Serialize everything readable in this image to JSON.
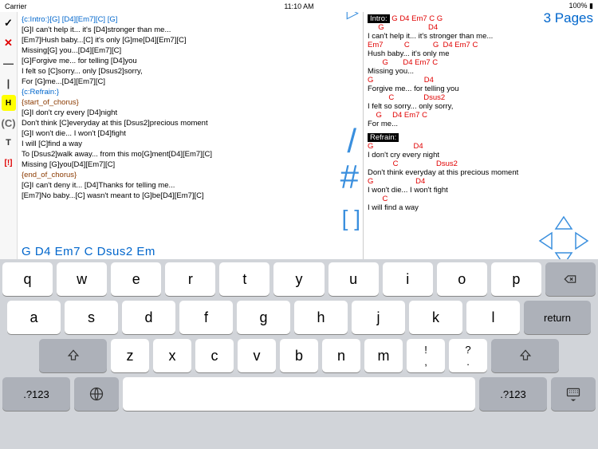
{
  "statusbar": {
    "carrier": "Carrier",
    "time": "11:10 AM",
    "battery": "100%"
  },
  "toolbar": {
    "check": "✓",
    "x": "✕",
    "minus": "—",
    "pipe": "|",
    "h": "H",
    "c": "(C)",
    "t": "T",
    "excl": "[!]"
  },
  "editor_lines": [
    {
      "cls": "blue",
      "t": "{c:Intro:}[G] [D4][Em7][C]  [G]"
    },
    {
      "cls": "",
      "t": " "
    },
    {
      "cls": "",
      "t": "[G]I can't help it... it's [D4]stronger than me..."
    },
    {
      "cls": "",
      "t": "[Em7]Hush baby...[C] it's only [G]me[D4][Em7][C]"
    },
    {
      "cls": "",
      "t": "Missing[G] you...[D4][Em7][C]"
    },
    {
      "cls": "",
      "t": "[G]Forgive me... for telling [D4]you"
    },
    {
      "cls": "",
      "t": "I felt so [C]sorry... only [Dsus2]sorry,"
    },
    {
      "cls": "",
      "t": "For [G]me...[D4][Em7][C]"
    },
    {
      "cls": "",
      "t": " "
    },
    {
      "cls": "blue",
      "t": "{c:Refrain:}"
    },
    {
      "cls": "br",
      "t": "{start_of_chorus}"
    },
    {
      "cls": "",
      "t": "[G]I don't cry every [D4]night"
    },
    {
      "cls": "",
      "t": "Don't think [C]everyday at this [Dsus2]precious moment"
    },
    {
      "cls": "",
      "t": "[G]I won't die... I won't [D4]fight"
    },
    {
      "cls": "",
      "t": "I will [C]find a way"
    },
    {
      "cls": "",
      "t": "To [Dsus2]walk away... from this mo[G]ment[D4][Em7][C]"
    },
    {
      "cls": "",
      "t": "Missing [G]you[D4][Em7][C]"
    },
    {
      "cls": "br",
      "t": "{end_of_chorus}"
    },
    {
      "cls": "",
      "t": " "
    },
    {
      "cls": "",
      "t": "[G]I can't deny it... [D4]Thanks for telling me..."
    },
    {
      "cls": "",
      "t": "[Em7]No baby...[C] wasn't meant to [G]be[D4][Em7][C]"
    }
  ],
  "chordbar": "G  D4  Em7  C  Dsus2  Em",
  "preview": {
    "pagecount": "3 Pages",
    "intro_label": "Intro:",
    "intro_chords": " G D4 Em7 C G",
    "rows": [
      {
        "c": "     G                     D4",
        "l": "I can't help it... it's stronger than me..."
      },
      {
        "c": "Em7          C           G  D4 Em7 C",
        "l": "Hush baby... it's only me"
      },
      {
        "c": "       G       D4 Em7 C",
        "l": "Missing you..."
      },
      {
        "c": "G                        D4",
        "l": "Forgive me... for telling you"
      },
      {
        "c": "          C              Dsus2",
        "l": "I felt so sorry... only sorry,"
      },
      {
        "c": "    G     D4 Em7 C",
        "l": "For me..."
      }
    ],
    "refrain_label": "Refrain:",
    "rows2": [
      {
        "c": "G                   D4",
        "l": "I don't cry every night"
      },
      {
        "c": "            C                  Dsus2",
        "l": "Don't think everyday at this precious moment"
      },
      {
        "c": "G                    D4",
        "l": "I won't die... I won't fight"
      },
      {
        "c": "       C",
        "l": "I will find a way"
      }
    ]
  },
  "symbols": {
    "play": "▷",
    "slash": "/",
    "hash": "#",
    "brackets": "[ ]"
  },
  "keyboard": {
    "row1": [
      "q",
      "w",
      "e",
      "r",
      "t",
      "y",
      "u",
      "i",
      "o",
      "p"
    ],
    "bksp": "⌫",
    "row2": [
      "a",
      "s",
      "d",
      "f",
      "g",
      "h",
      "j",
      "k",
      "l"
    ],
    "return": "return",
    "row3": [
      "z",
      "x",
      "c",
      "v",
      "b",
      "n",
      "m",
      ",",
      "!",
      ".",
      "?"
    ],
    "num": ".?123",
    "globe": "🌐"
  }
}
